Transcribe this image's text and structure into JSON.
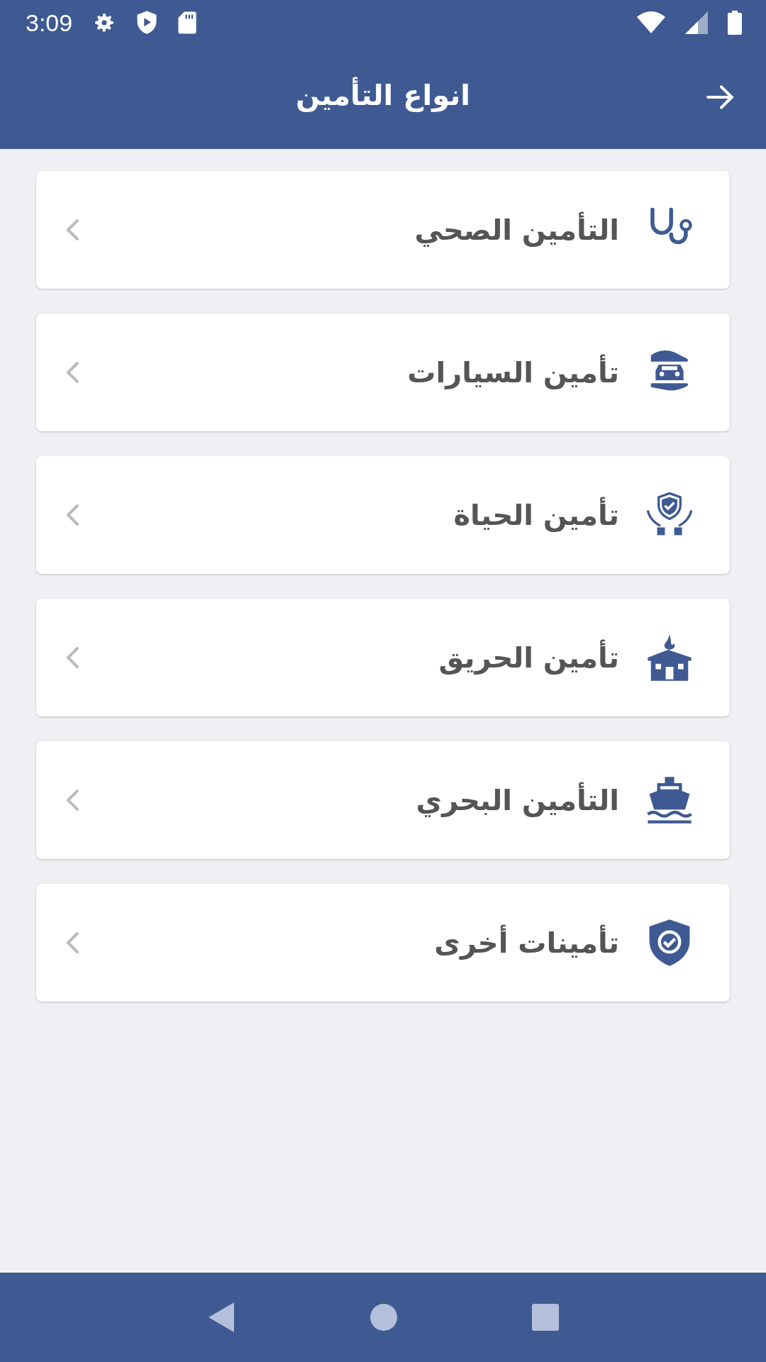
{
  "status_bar": {
    "time": "3:09"
  },
  "app_bar": {
    "title": "انواع التأمين"
  },
  "items": [
    {
      "kind": "health",
      "label": "التأمين الصحي"
    },
    {
      "kind": "car",
      "label": "تأمين السيارات"
    },
    {
      "kind": "life",
      "label": "تأمين الحياة"
    },
    {
      "kind": "fire",
      "label": "تأمين الحريق"
    },
    {
      "kind": "marine",
      "label": "التأمين البحري"
    },
    {
      "kind": "other",
      "label": "تأمينات أخرى"
    }
  ]
}
